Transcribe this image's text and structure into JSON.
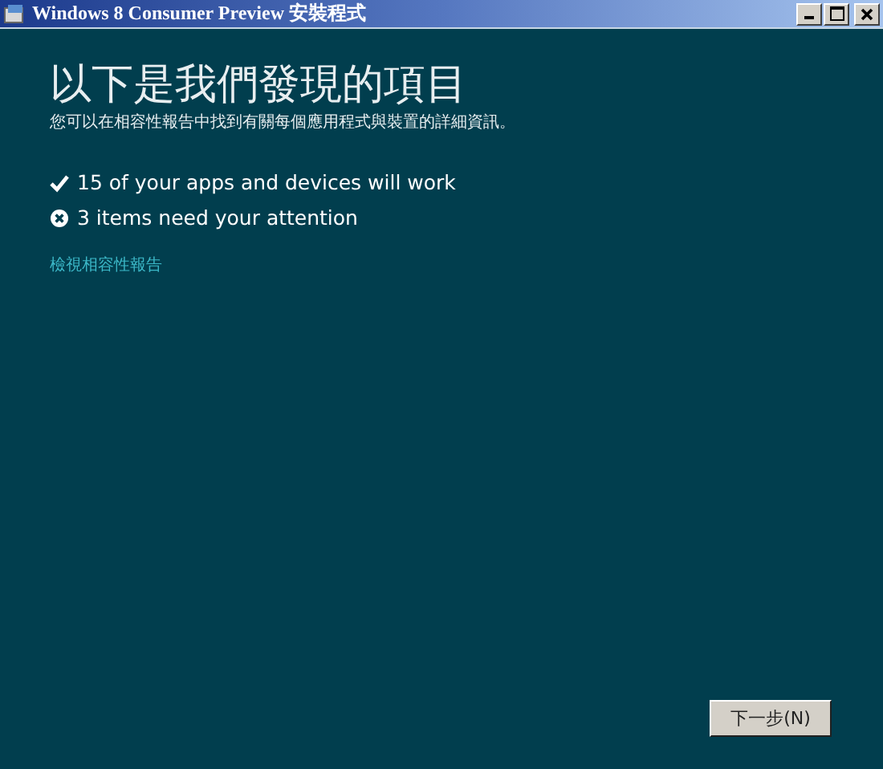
{
  "window": {
    "title": "Windows 8 Consumer Preview 安裝程式"
  },
  "heading": "以下是我們發現的項目",
  "subtitle": "您可以在相容性報告中找到有關每個應用程式與裝置的詳細資訊。",
  "results": [
    {
      "kind": "ok",
      "text": "15 of your apps and devices will work"
    },
    {
      "kind": "issue",
      "text": "3 items need your attention"
    }
  ],
  "link": "檢視相容性報告",
  "next_button": "下一步(N)"
}
